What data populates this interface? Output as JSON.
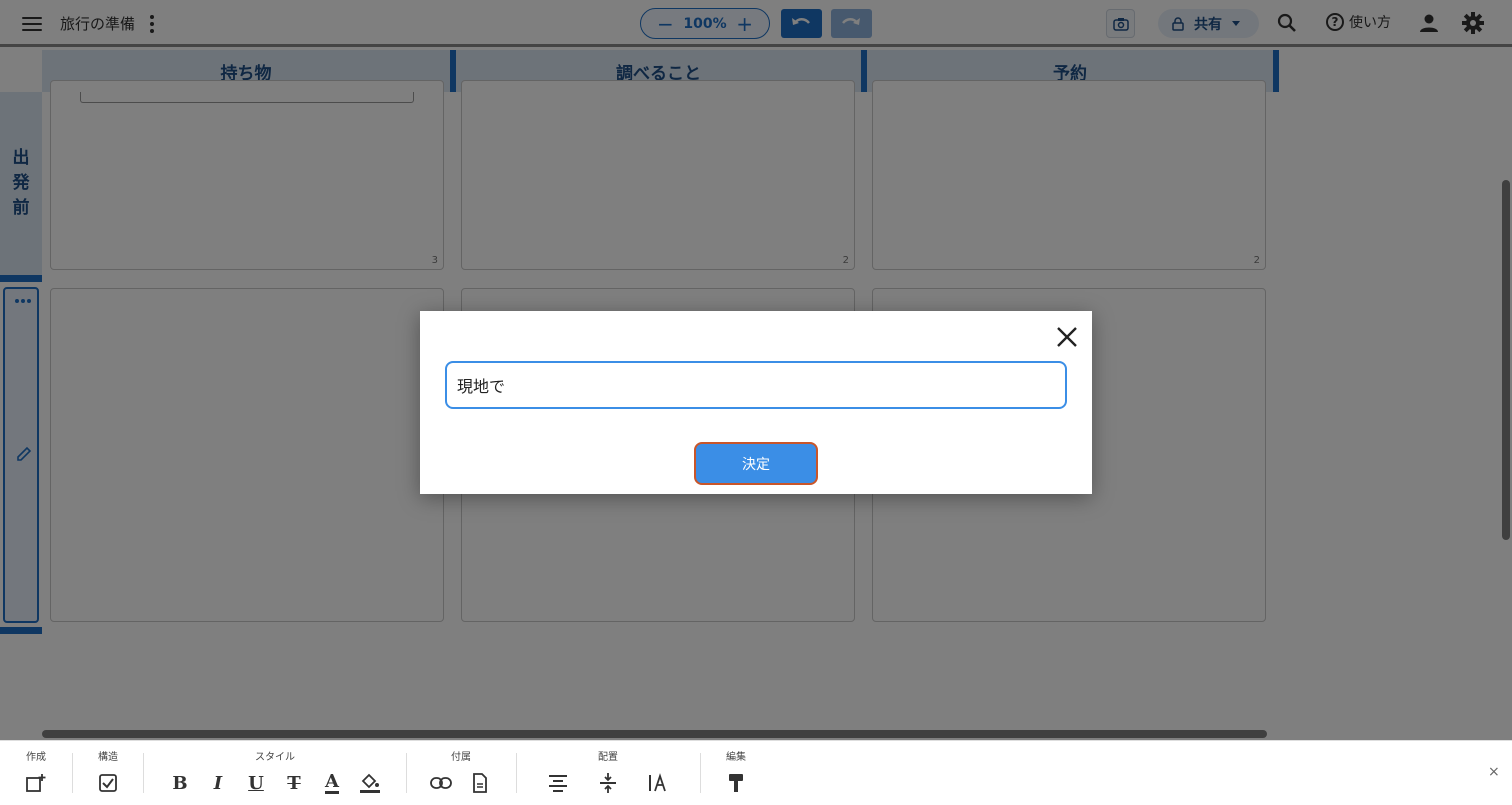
{
  "header": {
    "doc_title": "旅行の準備",
    "zoom_label": "100%",
    "zoom_minus": "−",
    "zoom_plus": "+",
    "share_label": "共有",
    "help_label": "使い方",
    "help_glyph": "?"
  },
  "board": {
    "columns": [
      "持ち物",
      "調べること",
      "予約"
    ],
    "rows": [
      {
        "label": "出\n発\n前",
        "counts": [
          "3",
          "2",
          "2"
        ]
      }
    ]
  },
  "dialog": {
    "input_value": "現地で",
    "confirm_label": "決定"
  },
  "toolbar": {
    "groups": {
      "create": "作成",
      "structure": "構造",
      "style": "スタイル",
      "attach": "付属",
      "layout": "配置",
      "edit": "編集"
    },
    "bold": "B",
    "italic": "I",
    "underline": "U",
    "strike": "T",
    "font_color": "A",
    "close": "×"
  },
  "colors": {
    "accent": "#1f6fc5",
    "header_fill": "#dbe6f3",
    "dialog_button": "#3b8ee6",
    "focus_ring": "#c9562a"
  }
}
